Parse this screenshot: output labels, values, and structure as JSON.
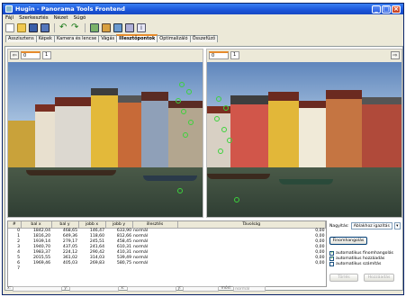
{
  "window": {
    "title": "Hugin - Panorama Tools Frontend"
  },
  "menu": [
    "Fájl",
    "Szerkesztés",
    "Nézet",
    "Súgó"
  ],
  "toolbar": [
    "new-icon",
    "open-icon",
    "save-icon",
    "save-as-icon",
    "undo-icon",
    "redo-icon",
    "preview-icon",
    "fast-preview-icon",
    "optimize-icon",
    "stitch-icon",
    "info-icon"
  ],
  "tabs": [
    "Asszisztens",
    "Képek",
    "Kamera és lencse",
    "Vágás",
    "Illesztőpontok",
    "Optimalizáló",
    "Összefűző"
  ],
  "active_tab": 4,
  "left_pane": {
    "tabs": [
      "0",
      "1"
    ]
  },
  "right_pane": {
    "tabs": [
      "0",
      "1"
    ]
  },
  "table": {
    "headers": [
      "#",
      "bal x",
      "bal y",
      "jobb x",
      "jobb y",
      "illesztés",
      "Távolság"
    ],
    "rows": [
      [
        "0",
        "1842,04",
        "468,65",
        "146,47",
        "633,90",
        "normál",
        "0,00"
      ],
      [
        "1",
        "1816,20",
        "649,36",
        "118,60",
        "812,66",
        "normál",
        "0,00"
      ],
      [
        "2",
        "1939,14",
        "279,17",
        "245,51",
        "458,45",
        "normál",
        "0,00"
      ],
      [
        "3",
        "1940,70",
        "437,05",
        "241,64",
        "610,31",
        "normál",
        "0,00"
      ],
      [
        "4",
        "1983,37",
        "224,12",
        "290,42",
        "410,31",
        "normál",
        "0,00"
      ],
      [
        "5",
        "2015,55",
        "361,02",
        "314,03",
        "539,49",
        "normál",
        "0,00"
      ],
      [
        "6",
        "1969,46",
        "405,03",
        "269,83",
        "580,75",
        "normál",
        "0,00"
      ],
      [
        "7",
        "",
        "",
        "",
        "",
        "",
        ""
      ]
    ]
  },
  "status": {
    "x_label": "x:",
    "y_label": "y:",
    "x2_label": "x:",
    "y2_label": "y:",
    "mode_label": "mód:",
    "mode_value": "normál"
  },
  "side": {
    "zoom_label": "Nagyítás:",
    "zoom_value": "Ablakhoz igazítás",
    "fine_tune": "Finomhangolás",
    "auto_fine_tune": "automatikus finomhangolás",
    "auto_add": "automatikus hozzáadás",
    "auto_estimate": "automatikus számítás",
    "delete": "Törlés",
    "add": "Hozzáadás"
  }
}
